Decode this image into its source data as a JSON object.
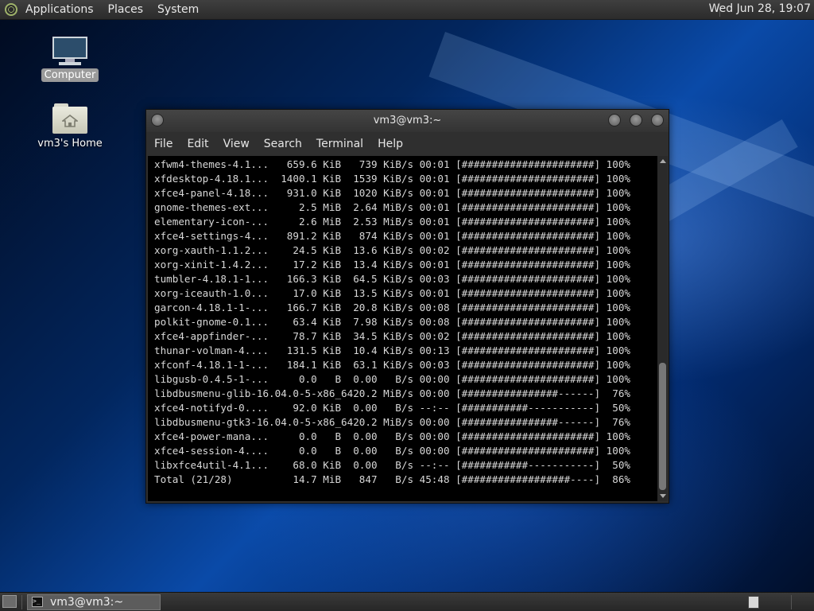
{
  "top_panel": {
    "menu": [
      "Applications",
      "Places",
      "System"
    ],
    "clock": "Wed Jun 28, 19:07"
  },
  "desktop_icons": [
    {
      "label": "Computer",
      "icon": "computer-icon"
    },
    {
      "label": "vm3's Home",
      "icon": "home-folder-icon"
    }
  ],
  "terminal": {
    "title": "vm3@vm3:~",
    "menu": [
      "File",
      "Edit",
      "View",
      "Search",
      "Terminal",
      "Help"
    ],
    "lines": [
      "xfwm4-themes-4.1...   659.6 KiB   739 KiB/s 00:01 [######################] 100%",
      "xfdesktop-4.18.1...  1400.1 KiB  1539 KiB/s 00:01 [######################] 100%",
      "xfce4-panel-4.18...   931.0 KiB  1020 KiB/s 00:01 [######################] 100%",
      "gnome-themes-ext...     2.5 MiB  2.64 MiB/s 00:01 [######################] 100%",
      "elementary-icon-...     2.6 MiB  2.53 MiB/s 00:01 [######################] 100%",
      "xfce4-settings-4...   891.2 KiB   874 KiB/s 00:01 [######################] 100%",
      "xorg-xauth-1.1.2...    24.5 KiB  13.6 KiB/s 00:02 [######################] 100%",
      "xorg-xinit-1.4.2...    17.2 KiB  13.4 KiB/s 00:01 [######################] 100%",
      "tumbler-4.18.1-1...   166.3 KiB  64.5 KiB/s 00:03 [######################] 100%",
      "xorg-iceauth-1.0...    17.0 KiB  13.5 KiB/s 00:01 [######################] 100%",
      "garcon-4.18.1-1-...   166.7 KiB  20.8 KiB/s 00:08 [######################] 100%",
      "polkit-gnome-0.1...    63.4 KiB  7.98 KiB/s 00:08 [######################] 100%",
      "xfce4-appfinder-...    78.7 KiB  34.5 KiB/s 00:02 [######################] 100%",
      "thunar-volman-4....   131.5 KiB  10.4 KiB/s 00:13 [######################] 100%",
      "xfconf-4.18.1-1-...   184.1 KiB  63.1 KiB/s 00:03 [######################] 100%",
      "libgusb-0.4.5-1-...     0.0   B  0.00   B/s 00:00 [######################] 100%",
      "libdbusmenu-glib-16.04.0-5-x86_6420.2 MiB/s 00:00 [################------]  76%",
      "xfce4-notifyd-0....    92.0 KiB  0.00   B/s --:-- [###########-----------]  50%",
      "libdbusmenu-gtk3-16.04.0-5-x86_6420.2 MiB/s 00:00 [################------]  76%",
      "xfce4-power-mana...     0.0   B  0.00   B/s 00:00 [######################] 100%",
      "xfce4-session-4....     0.0   B  0.00   B/s 00:00 [######################] 100%",
      "libxfce4util-4.1...    68.0 KiB  0.00   B/s --:-- [###########-----------]  50%",
      "Total (21/28)          14.7 MiB   847   B/s 45:48 [##################----]  86%"
    ]
  },
  "taskbar": {
    "task_label": "vm3@vm3:~"
  }
}
